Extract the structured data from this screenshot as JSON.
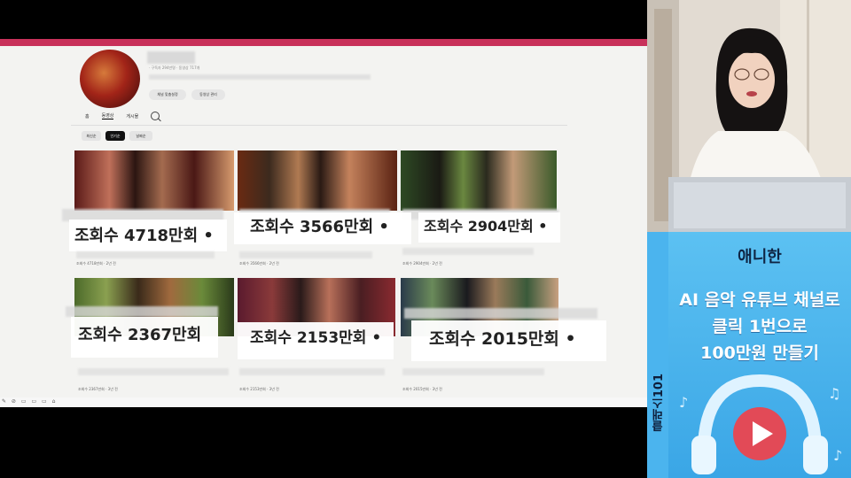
{
  "screen": {
    "channel_meta": "· 구독자 294만명 · 동영상 717개",
    "buttons": {
      "customize": "채널 맞춤설정",
      "manage_videos": "동영상 관리"
    },
    "tabs": [
      "홈",
      "동영상",
      "게시물"
    ],
    "chips": [
      "최신순",
      "인기순",
      "날짜순"
    ],
    "videos": [
      {
        "views": "조회수 4718만회 •",
        "meta": "조회수 4718만회 · 2년 전"
      },
      {
        "views": "조회수 3566만회 •",
        "meta": "조회수 3566만회 · 2년 전"
      },
      {
        "views": "조회수 2904만회 •",
        "meta": "조회수 2904만회 · 2년 전"
      },
      {
        "views": "조회수 2367만회",
        "meta": "조회수 2367만회 · 3년 전"
      },
      {
        "views": "조회수 2153만회 •",
        "meta": "조회수 2153만회 · 3년 전"
      },
      {
        "views": "조회수 2015만회 •",
        "meta": "조회수 2015만회 · 3년 전"
      }
    ]
  },
  "banner": {
    "side_text": "클래스101",
    "title": "애니한",
    "line1": "AI 음악 유튜브 채널로",
    "line2": "클릭 1번으로",
    "line3": "100만원 만들기"
  },
  "colors": {
    "banner_bg": "#4bb4ee",
    "top_bar": "#c8315a"
  }
}
